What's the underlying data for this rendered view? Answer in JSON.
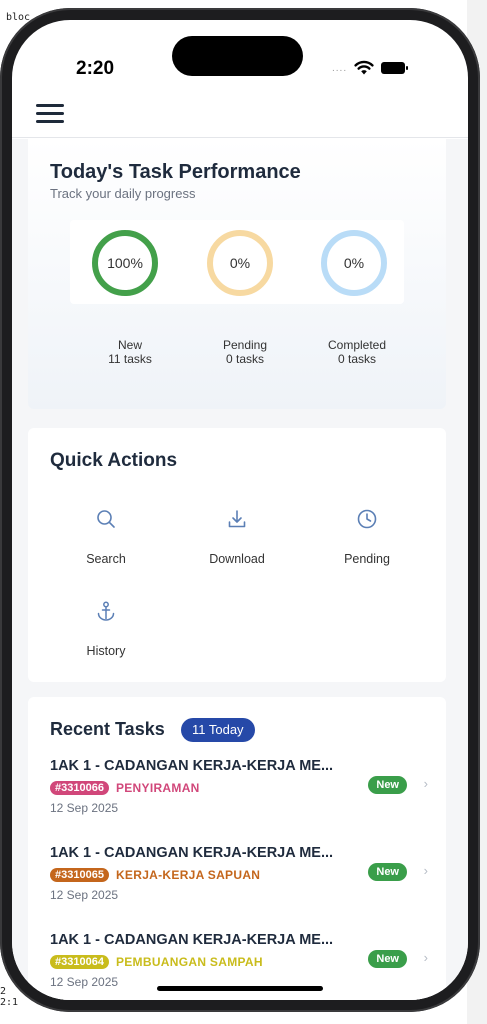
{
  "backdrop": {
    "top_left": "bloc",
    "bottom_left_1": "2",
    "bottom_left_2": "2:1"
  },
  "status_bar": {
    "time": "2:20",
    "signal": "....",
    "wifi_icon": "wifi-icon",
    "battery_icon": "battery-icon"
  },
  "app_bar": {
    "menu_icon": "hamburger-menu-icon"
  },
  "performance": {
    "title": "Today's Task Performance",
    "subtitle": "Track your daily progress",
    "rings": [
      {
        "percent": "100%",
        "label": "New",
        "count": "11 tasks",
        "color": "#43a04a",
        "fraction": 1.0
      },
      {
        "percent": "0%",
        "label": "Pending",
        "count": "0 tasks",
        "color": "#f7d9a1",
        "fraction": 0.0
      },
      {
        "percent": "0%",
        "label": "Completed",
        "count": "0 tasks",
        "color": "#b9dcf7",
        "fraction": 0.0
      }
    ]
  },
  "quick_actions": {
    "title": "Quick Actions",
    "items": [
      {
        "label": "Search",
        "icon": "search-icon"
      },
      {
        "label": "Download",
        "icon": "download-icon"
      },
      {
        "label": "Pending",
        "icon": "clock-icon"
      },
      {
        "label": "History",
        "icon": "anchor-icon"
      }
    ],
    "icon_color": "#5b7fb5"
  },
  "recent_tasks": {
    "title": "Recent Tasks",
    "badge": "11 Today",
    "items": [
      {
        "title": "1AK 1 - CADANGAN KERJA-KERJA ME...",
        "id": "#3310066",
        "category": "PENYIRAMAN",
        "date": "12 Sep 2025",
        "status": "New",
        "color": "#d1477a"
      },
      {
        "title": "1AK 1 - CADANGAN KERJA-KERJA ME...",
        "id": "#3310065",
        "category": "KERJA-KERJA SAPUAN",
        "date": "12 Sep 2025",
        "status": "New",
        "color": "#c4661c"
      },
      {
        "title": "1AK 1 - CADANGAN KERJA-KERJA ME...",
        "id": "#3310064",
        "category": "PEMBUANGAN SAMPAH",
        "date": "12 Sep 2025",
        "status": "New",
        "color": "#c9bc1c"
      }
    ]
  }
}
